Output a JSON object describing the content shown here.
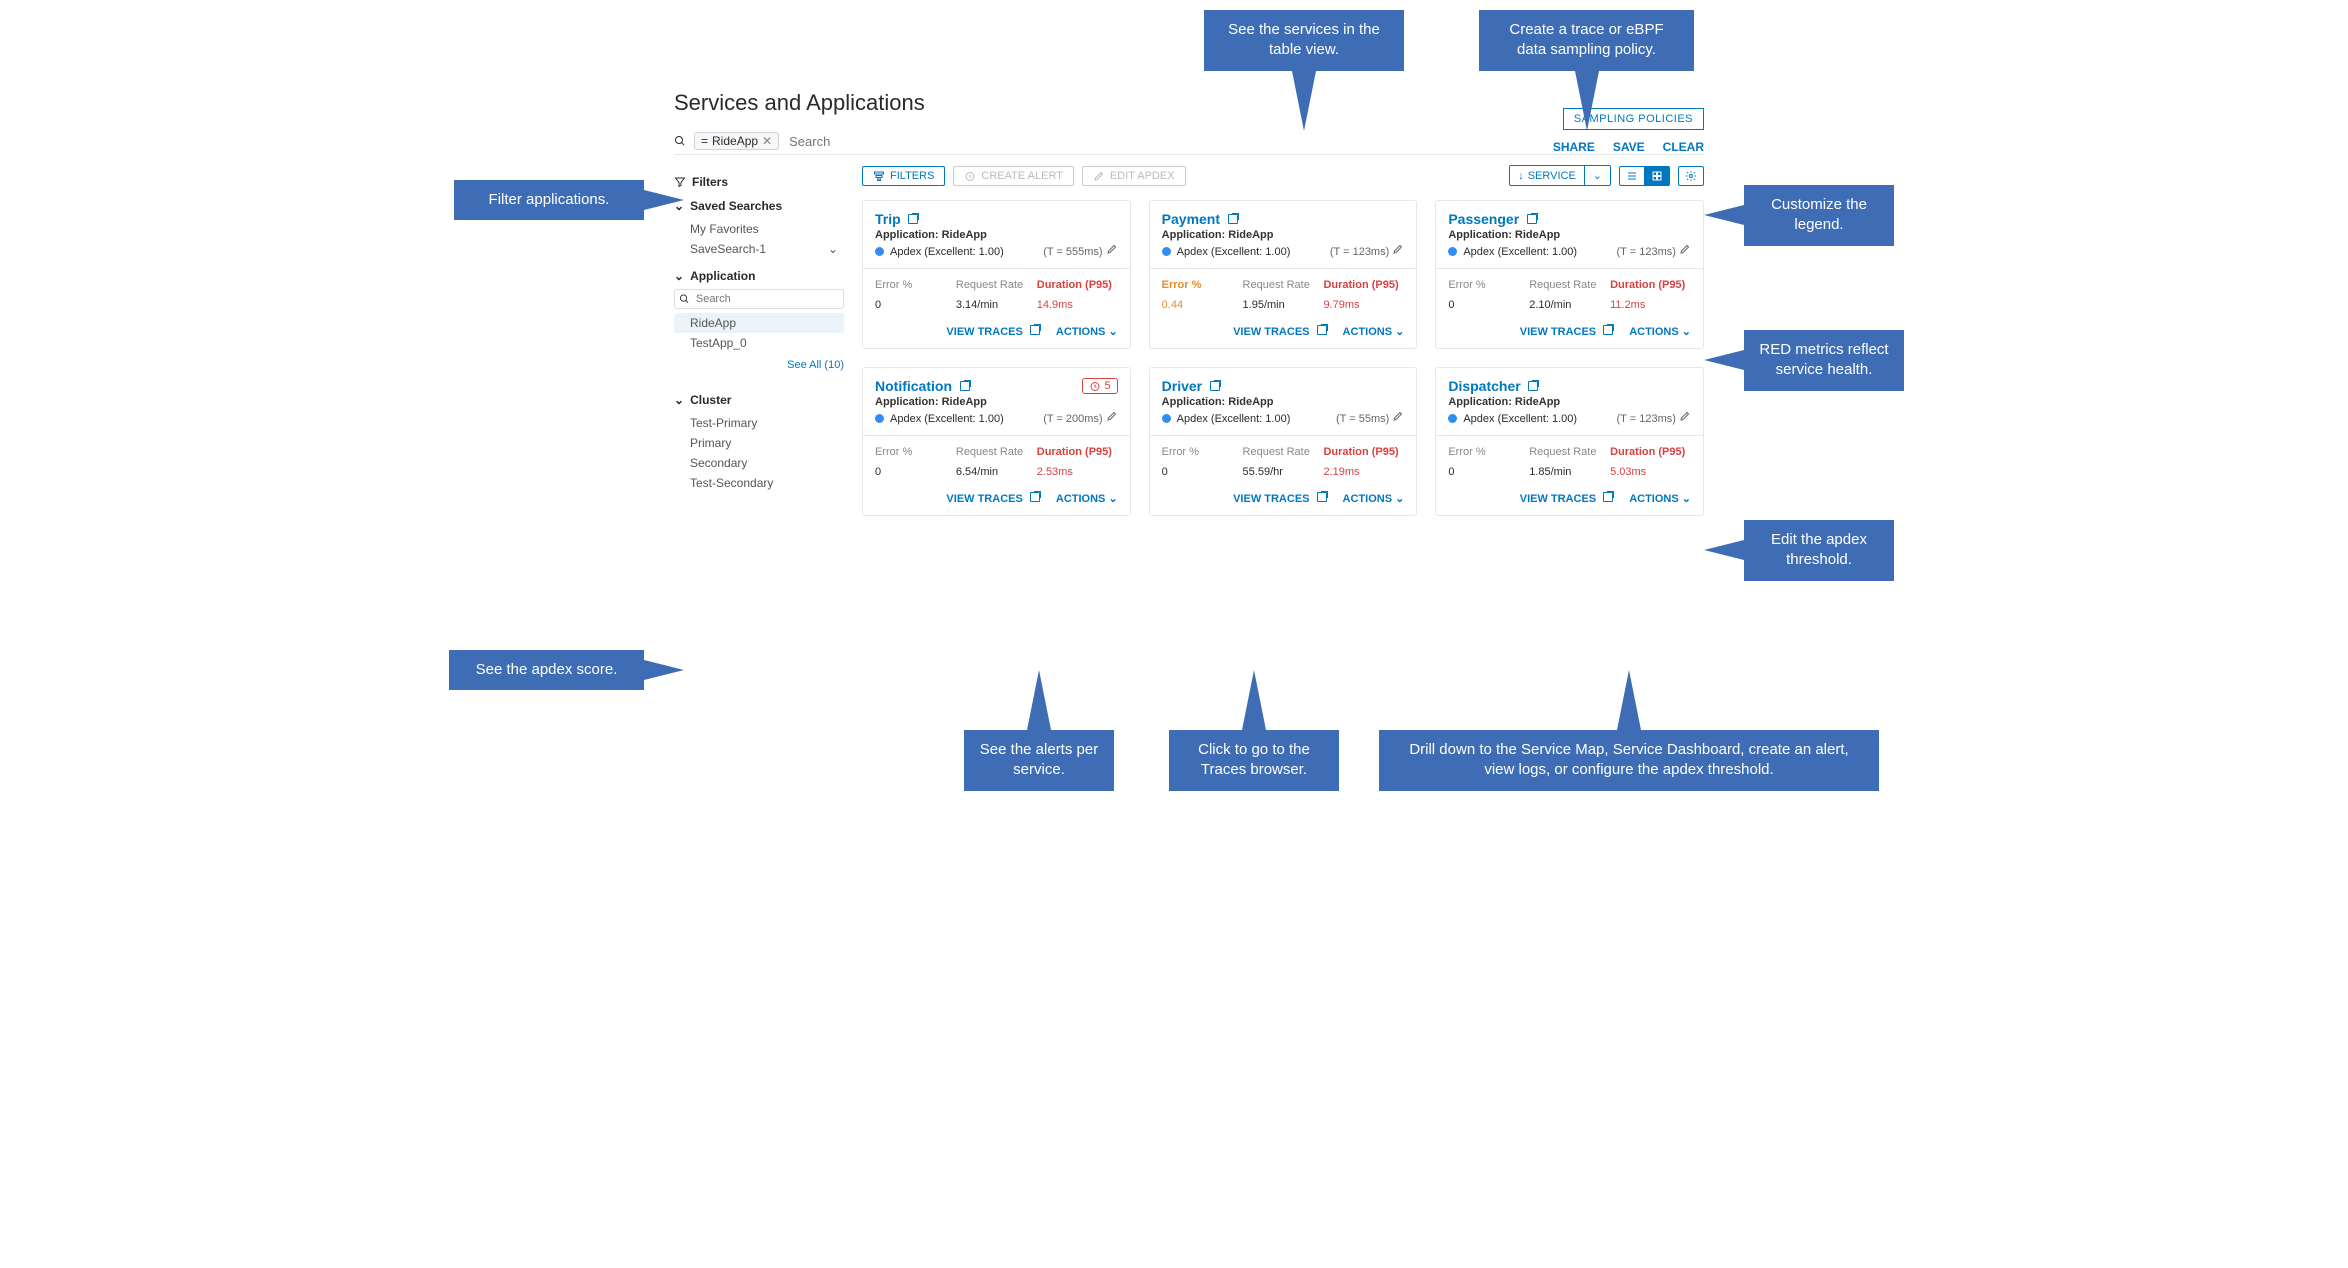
{
  "title": "Services and Applications",
  "chip_label": "RideApp",
  "search_placeholder": "Search",
  "topright": {
    "share": "SHARE",
    "save": "SAVE",
    "clear": "CLEAR"
  },
  "policies": "SAMPLING POLICIES",
  "chip_eq": "=",
  "toolbar": {
    "filters": "FILTERS",
    "create_alert": "CREATE ALERT",
    "edit_apdex": "EDIT APDEX",
    "sort": "SERVICE"
  },
  "sidebar": {
    "filters": "Filters",
    "saved": "Saved Searches",
    "myfav": "My Favorites",
    "ss1": "SaveSearch-1",
    "app": "Application",
    "search_ph": "Search",
    "app1": "RideApp",
    "app2": "TestApp_0",
    "see_all": "See All (10)",
    "cluster": "Cluster",
    "c1": "Test-Primary",
    "c2": "Primary",
    "c3": "Secondary",
    "c4": "Test-Secondary"
  },
  "labels": {
    "appline_prefix": "Application: ",
    "apdex": "Apdex (Excellent: 1.00)",
    "err": "Error %",
    "rate": "Request Rate",
    "dur": "Duration (P95)",
    "view": "VIEW TRACES",
    "actions": "ACTIONS"
  },
  "cards": [
    {
      "name": "Trip",
      "app": "RideApp",
      "t": "(T = 555ms)",
      "err": "0",
      "rate": "3.14/min",
      "dur": "14.9ms"
    },
    {
      "name": "Payment",
      "app": "RideApp",
      "t": "(T = 123ms)",
      "err": "0.44",
      "err_warn": true,
      "rate": "1.95/min",
      "dur": "9.79ms"
    },
    {
      "name": "Passenger",
      "app": "RideApp",
      "t": "(T = 123ms)",
      "err": "0",
      "rate": "2.10/min",
      "dur": "11.2ms"
    },
    {
      "name": "Notification",
      "app": "RideApp",
      "t": "(T = 200ms)",
      "alerts": "5",
      "err": "0",
      "rate": "6.54/min",
      "dur": "2.53ms"
    },
    {
      "name": "Driver",
      "app": "RideApp",
      "t": "(T = 55ms)",
      "err": "0",
      "rate": "55.59/hr",
      "dur": "2.19ms"
    },
    {
      "name": "Dispatcher",
      "app": "RideApp",
      "t": "(T = 123ms)",
      "err": "0",
      "rate": "1.85/min",
      "dur": "5.03ms"
    }
  ],
  "callouts": {
    "filter": "Filter applications.",
    "table": "See the services in the table view.",
    "policy": "Create a trace or eBPF data sampling policy.",
    "legend": "Customize the legend.",
    "red": "RED metrics reflect service health.",
    "thr": "Edit the apdex threshold.",
    "actions": "Drill down to the Service Map, Service Dashboard, create an alert, view logs, or configure the apdex threshold.",
    "traces": "Click to go to the Traces browser.",
    "alerts": "See the alerts per service.",
    "apdex": "See the apdex score."
  }
}
